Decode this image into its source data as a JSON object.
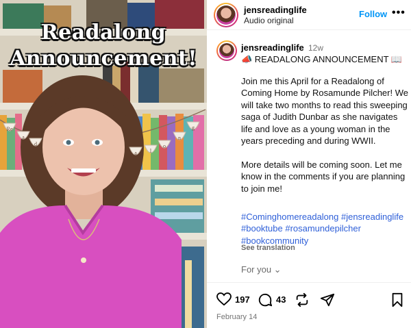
{
  "media": {
    "title_line1": "Readalong",
    "title_line2": "Announcement!",
    "banner_letters": [
      "Re",
      "a",
      "d",
      "a",
      "l",
      "o",
      "n",
      "g"
    ]
  },
  "header": {
    "username": "jensreadinglife",
    "subtitle": "Audio original",
    "follow_label": "Follow",
    "more_label": "•••"
  },
  "caption": {
    "username": "jensreadinglife",
    "time": "12w",
    "heading": "📣 READALONG ANNOUNCEMENT 📖",
    "paragraphs": [
      "Join me this April for a Readalong of Coming Home by Rosamunde Pilcher! We will take two months to read this sweeping saga of Judith Dunbar as she navigates life and love as a young woman in the years preceding and during WWII.",
      "More details will be coming soon. Let me know in the comments if you are planning to join me!"
    ],
    "hashtags": "#Cominghomereadalong #jensreadinglife #booktube #rosamundepilcher #bookcommunity",
    "see_translation": "See translation",
    "for_you": "For you ⌄"
  },
  "actions": {
    "likes": "197",
    "comments": "43",
    "date": "February 14"
  },
  "colors": {
    "link_blue": "#0095f6",
    "hashtag_blue": "#2e5fd8",
    "shirt_pink": "#d84fc0"
  }
}
